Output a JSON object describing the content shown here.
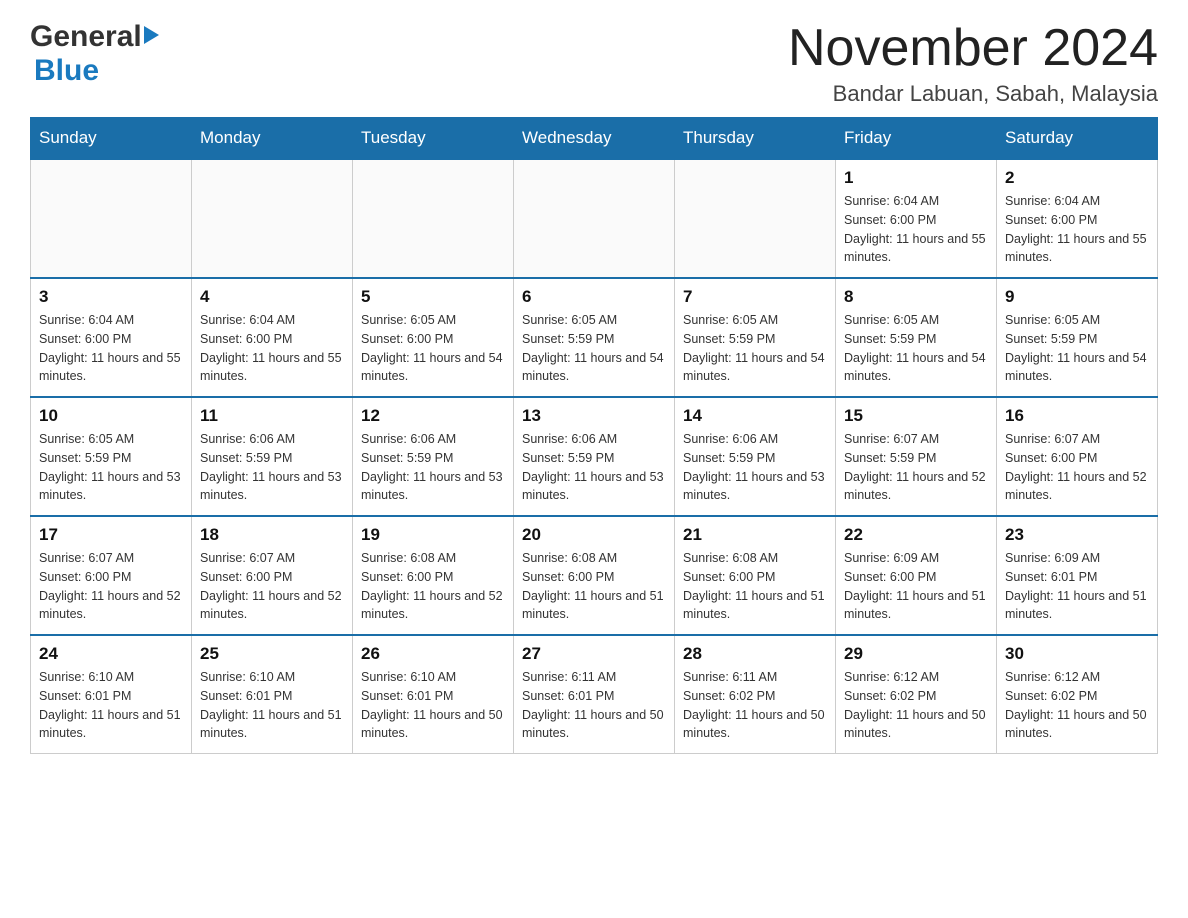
{
  "logo": {
    "general": "General",
    "blue": "Blue"
  },
  "title": "November 2024",
  "location": "Bandar Labuan, Sabah, Malaysia",
  "weekdays": [
    "Sunday",
    "Monday",
    "Tuesday",
    "Wednesday",
    "Thursday",
    "Friday",
    "Saturday"
  ],
  "weeks": [
    [
      {
        "day": "",
        "info": ""
      },
      {
        "day": "",
        "info": ""
      },
      {
        "day": "",
        "info": ""
      },
      {
        "day": "",
        "info": ""
      },
      {
        "day": "",
        "info": ""
      },
      {
        "day": "1",
        "info": "Sunrise: 6:04 AM\nSunset: 6:00 PM\nDaylight: 11 hours and 55 minutes."
      },
      {
        "day": "2",
        "info": "Sunrise: 6:04 AM\nSunset: 6:00 PM\nDaylight: 11 hours and 55 minutes."
      }
    ],
    [
      {
        "day": "3",
        "info": "Sunrise: 6:04 AM\nSunset: 6:00 PM\nDaylight: 11 hours and 55 minutes."
      },
      {
        "day": "4",
        "info": "Sunrise: 6:04 AM\nSunset: 6:00 PM\nDaylight: 11 hours and 55 minutes."
      },
      {
        "day": "5",
        "info": "Sunrise: 6:05 AM\nSunset: 6:00 PM\nDaylight: 11 hours and 54 minutes."
      },
      {
        "day": "6",
        "info": "Sunrise: 6:05 AM\nSunset: 5:59 PM\nDaylight: 11 hours and 54 minutes."
      },
      {
        "day": "7",
        "info": "Sunrise: 6:05 AM\nSunset: 5:59 PM\nDaylight: 11 hours and 54 minutes."
      },
      {
        "day": "8",
        "info": "Sunrise: 6:05 AM\nSunset: 5:59 PM\nDaylight: 11 hours and 54 minutes."
      },
      {
        "day": "9",
        "info": "Sunrise: 6:05 AM\nSunset: 5:59 PM\nDaylight: 11 hours and 54 minutes."
      }
    ],
    [
      {
        "day": "10",
        "info": "Sunrise: 6:05 AM\nSunset: 5:59 PM\nDaylight: 11 hours and 53 minutes."
      },
      {
        "day": "11",
        "info": "Sunrise: 6:06 AM\nSunset: 5:59 PM\nDaylight: 11 hours and 53 minutes."
      },
      {
        "day": "12",
        "info": "Sunrise: 6:06 AM\nSunset: 5:59 PM\nDaylight: 11 hours and 53 minutes."
      },
      {
        "day": "13",
        "info": "Sunrise: 6:06 AM\nSunset: 5:59 PM\nDaylight: 11 hours and 53 minutes."
      },
      {
        "day": "14",
        "info": "Sunrise: 6:06 AM\nSunset: 5:59 PM\nDaylight: 11 hours and 53 minutes."
      },
      {
        "day": "15",
        "info": "Sunrise: 6:07 AM\nSunset: 5:59 PM\nDaylight: 11 hours and 52 minutes."
      },
      {
        "day": "16",
        "info": "Sunrise: 6:07 AM\nSunset: 6:00 PM\nDaylight: 11 hours and 52 minutes."
      }
    ],
    [
      {
        "day": "17",
        "info": "Sunrise: 6:07 AM\nSunset: 6:00 PM\nDaylight: 11 hours and 52 minutes."
      },
      {
        "day": "18",
        "info": "Sunrise: 6:07 AM\nSunset: 6:00 PM\nDaylight: 11 hours and 52 minutes."
      },
      {
        "day": "19",
        "info": "Sunrise: 6:08 AM\nSunset: 6:00 PM\nDaylight: 11 hours and 52 minutes."
      },
      {
        "day": "20",
        "info": "Sunrise: 6:08 AM\nSunset: 6:00 PM\nDaylight: 11 hours and 51 minutes."
      },
      {
        "day": "21",
        "info": "Sunrise: 6:08 AM\nSunset: 6:00 PM\nDaylight: 11 hours and 51 minutes."
      },
      {
        "day": "22",
        "info": "Sunrise: 6:09 AM\nSunset: 6:00 PM\nDaylight: 11 hours and 51 minutes."
      },
      {
        "day": "23",
        "info": "Sunrise: 6:09 AM\nSunset: 6:01 PM\nDaylight: 11 hours and 51 minutes."
      }
    ],
    [
      {
        "day": "24",
        "info": "Sunrise: 6:10 AM\nSunset: 6:01 PM\nDaylight: 11 hours and 51 minutes."
      },
      {
        "day": "25",
        "info": "Sunrise: 6:10 AM\nSunset: 6:01 PM\nDaylight: 11 hours and 51 minutes."
      },
      {
        "day": "26",
        "info": "Sunrise: 6:10 AM\nSunset: 6:01 PM\nDaylight: 11 hours and 50 minutes."
      },
      {
        "day": "27",
        "info": "Sunrise: 6:11 AM\nSunset: 6:01 PM\nDaylight: 11 hours and 50 minutes."
      },
      {
        "day": "28",
        "info": "Sunrise: 6:11 AM\nSunset: 6:02 PM\nDaylight: 11 hours and 50 minutes."
      },
      {
        "day": "29",
        "info": "Sunrise: 6:12 AM\nSunset: 6:02 PM\nDaylight: 11 hours and 50 minutes."
      },
      {
        "day": "30",
        "info": "Sunrise: 6:12 AM\nSunset: 6:02 PM\nDaylight: 11 hours and 50 minutes."
      }
    ]
  ]
}
